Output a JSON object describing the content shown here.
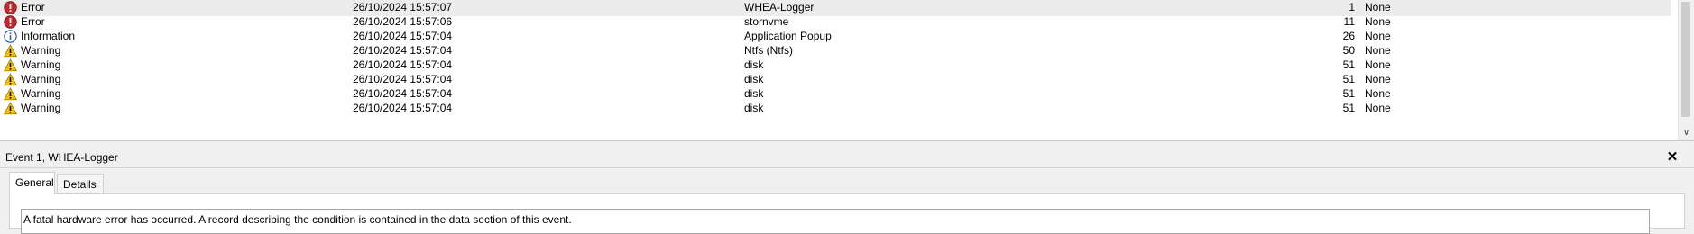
{
  "events": [
    {
      "level": "Error",
      "icon": "error-icon",
      "date": "26/10/2024 15:57:07",
      "source": "WHEA-Logger",
      "event_id": "1",
      "task": "None"
    },
    {
      "level": "Error",
      "icon": "error-icon",
      "date": "26/10/2024 15:57:06",
      "source": "stornvme",
      "event_id": "11",
      "task": "None"
    },
    {
      "level": "Information",
      "icon": "information-icon",
      "date": "26/10/2024 15:57:04",
      "source": "Application Popup",
      "event_id": "26",
      "task": "None"
    },
    {
      "level": "Warning",
      "icon": "warning-icon",
      "date": "26/10/2024 15:57:04",
      "source": "Ntfs (Ntfs)",
      "event_id": "50",
      "task": "None"
    },
    {
      "level": "Warning",
      "icon": "warning-icon",
      "date": "26/10/2024 15:57:04",
      "source": "disk",
      "event_id": "51",
      "task": "None"
    },
    {
      "level": "Warning",
      "icon": "warning-icon",
      "date": "26/10/2024 15:57:04",
      "source": "disk",
      "event_id": "51",
      "task": "None"
    },
    {
      "level": "Warning",
      "icon": "warning-icon",
      "date": "26/10/2024 15:57:04",
      "source": "disk",
      "event_id": "51",
      "task": "None"
    },
    {
      "level": "Warning",
      "icon": "warning-icon",
      "date": "26/10/2024 15:57:04",
      "source": "disk",
      "event_id": "51",
      "task": "None"
    }
  ],
  "selected_index": 0,
  "detail": {
    "title": "Event 1, WHEA-Logger",
    "close_icon": "close-icon",
    "tabs": [
      "General",
      "Details"
    ],
    "active_tab": "General",
    "description": "A fatal hardware error has occurred. A record describing the condition is contained in the data section of this event."
  },
  "scrollbar": {
    "down_icon": "chevron-down-icon"
  },
  "colors": {
    "error": "#c0282e",
    "information": "#2b5aa6",
    "warning": "#f5c400",
    "selected_row": "#ececec"
  }
}
